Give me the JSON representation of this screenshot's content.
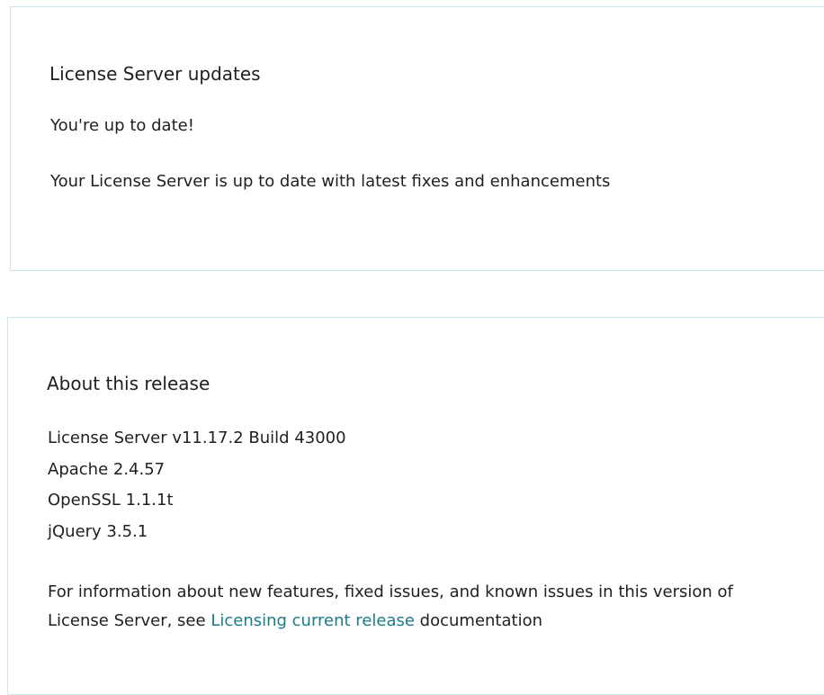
{
  "updates": {
    "title": "License Server updates",
    "status": "You're up to date!",
    "description": "Your License Server is up to date with latest fixes and enhancements"
  },
  "about": {
    "title": "About this release",
    "versions": [
      "License Server v11.17.2 Build 43000",
      "Apache 2.4.57",
      "OpenSSL 1.1.1t",
      "jQuery 3.5.1"
    ],
    "info_prefix": "For information about new features, fixed issues, and known issues in this version of License Server, see ",
    "link_label": "Licensing current release",
    "info_suffix": " documentation"
  },
  "colors": {
    "card_border": "#c6e7ee",
    "link": "#1b7b8a",
    "text": "#1f1f1f"
  }
}
